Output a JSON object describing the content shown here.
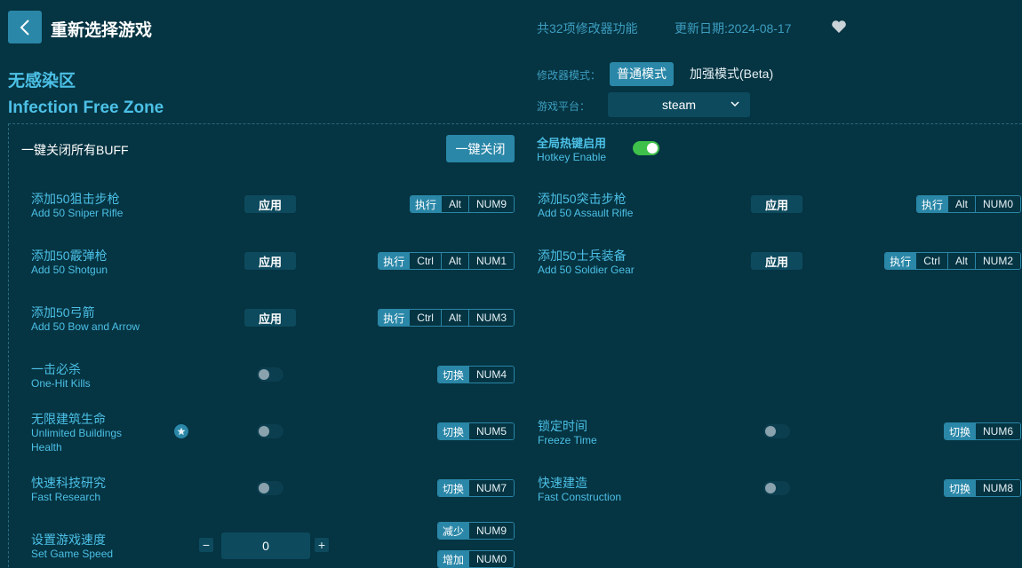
{
  "header": {
    "title": "重新选择游戏",
    "feature_count": "共32项修改器功能",
    "update_date": "更新日期:2024-08-17"
  },
  "game": {
    "name_cn": "无感染区",
    "name_en": "Infection Free Zone"
  },
  "mode": {
    "label": "修改器模式：",
    "normal": "普通模式",
    "beta": "加强模式(Beta)",
    "selected": "普通模式"
  },
  "platform": {
    "label": "游戏平台：",
    "value": "steam"
  },
  "buff": {
    "label": "一键关闭所有BUFF",
    "button": "一键关闭"
  },
  "hotkey": {
    "cn": "全局热键启用",
    "en": "Hotkey Enable",
    "enabled": true
  },
  "labels": {
    "apply": "应用",
    "exec": "执行",
    "toggle": "切换",
    "decrease": "减少",
    "increase": "增加",
    "minus": "−",
    "plus": "+"
  },
  "options": [
    {
      "cn": "添加50狙击步枪",
      "en": "Add 50 Sniper Rifle",
      "type": "apply",
      "keys": [
        "Alt",
        "NUM9"
      ]
    },
    {
      "cn": "添加50突击步枪",
      "en": "Add 50 Assault Rifle",
      "type": "apply",
      "keys": [
        "Alt",
        "NUM0"
      ]
    },
    {
      "cn": "添加50霰弹枪",
      "en": "Add 50 Shotgun",
      "type": "apply",
      "keys": [
        "Ctrl",
        "Alt",
        "NUM1"
      ]
    },
    {
      "cn": "添加50士兵装备",
      "en": "Add 50 Soldier Gear",
      "type": "apply",
      "keys": [
        "Ctrl",
        "Alt",
        "NUM2"
      ]
    },
    {
      "cn": "添加50弓箭",
      "en": "Add 50 Bow and Arrow",
      "type": "apply",
      "keys": [
        "Ctrl",
        "Alt",
        "NUM3"
      ]
    },
    {
      "cn": "一击必杀",
      "en": "One-Hit Kills",
      "type": "toggle",
      "keys": [
        "NUM4"
      ],
      "on": false
    },
    {
      "cn": "无限建筑生命",
      "en": "Unlimited Buildings",
      "en2": "Health",
      "type": "toggle",
      "keys": [
        "NUM5"
      ],
      "on": false,
      "starred": true
    },
    {
      "cn": "锁定时间",
      "en": "Freeze Time",
      "type": "toggle",
      "keys": [
        "NUM6"
      ],
      "on": false
    },
    {
      "cn": "快速科技研究",
      "en": "Fast Research",
      "type": "toggle",
      "keys": [
        "NUM7"
      ],
      "on": false
    },
    {
      "cn": "快速建造",
      "en": "Fast Construction",
      "type": "toggle",
      "keys": [
        "NUM8"
      ],
      "on": false
    },
    {
      "cn": "设置游戏速度",
      "en": "Set Game Speed",
      "type": "stepper",
      "value": "0",
      "dec_keys": [
        "NUM9"
      ],
      "inc_keys": [
        "NUM0"
      ]
    }
  ],
  "colors": {
    "background": "#053442",
    "accent": "#2a87a8",
    "label": "#4cc0e6",
    "toggle_on": "#3fc04a"
  }
}
